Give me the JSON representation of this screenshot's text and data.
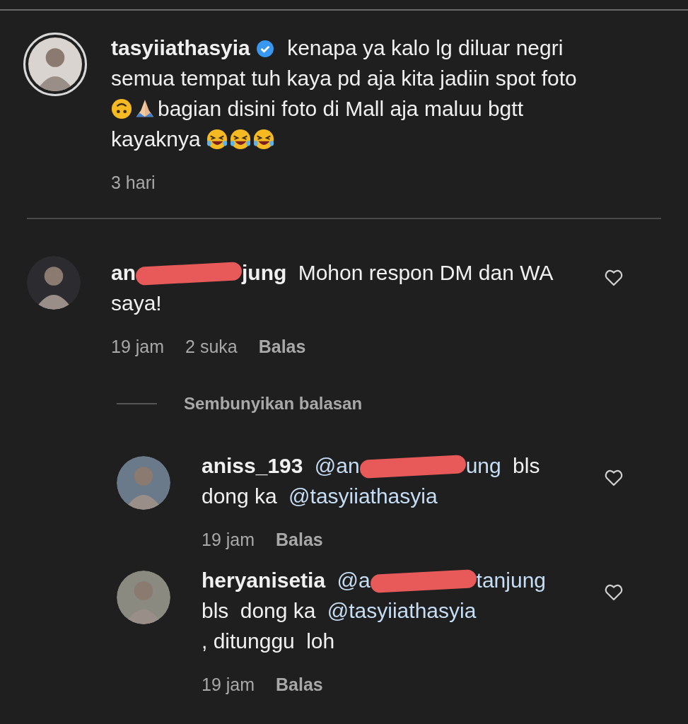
{
  "post": {
    "username": "tasyiiathasyia",
    "verified": true,
    "caption": [
      {
        "kind": "text",
        "text": "kenapa ya kalo lg diluar negri"
      },
      {
        "kind": "text",
        "text": "semua tempat tuh kaya pd aja kita jadiin spot foto"
      },
      {
        "kind": "upside_down_face"
      },
      {
        "kind": "folded_hands"
      },
      {
        "kind": "text",
        "text": "bagian disini foto di Mall aja maluu bgtt"
      },
      {
        "kind": "text",
        "text": "kayaknya"
      },
      {
        "kind": "rolling_laugh"
      },
      {
        "kind": "rolling_laugh"
      },
      {
        "kind": "rolling_laugh"
      }
    ],
    "time": "3 hari"
  },
  "comment": {
    "username": [
      {
        "kind": "text",
        "text": "an"
      },
      {
        "kind": "redaction"
      },
      {
        "kind": "text",
        "text": "jung"
      }
    ],
    "text": [
      {
        "kind": "text",
        "text": "Mohon respon DM dan WA"
      },
      {
        "kind": "text",
        "text": "saya!"
      }
    ],
    "time": "19 jam",
    "likes": "2 suka",
    "reply": "Balas"
  },
  "replies_toggle": "Sembunyikan balasan",
  "replies": [
    {
      "username": [
        {
          "kind": "text",
          "text": "aniss_193"
        }
      ],
      "text": [
        {
          "kind": "mention",
          "text": "@an"
        },
        {
          "kind": "redaction"
        },
        {
          "kind": "mention",
          "text": "ung"
        },
        {
          "kind": "text",
          "text": "bls"
        },
        {
          "kind": "text",
          "text": "dong ka"
        },
        {
          "kind": "mention",
          "text": "@tasyiiathasyia"
        }
      ],
      "time": "19 jam",
      "reply": "Balas"
    },
    {
      "username": [
        {
          "kind": "text",
          "text": "heryanisetia"
        }
      ],
      "text": [
        {
          "kind": "mention",
          "text": "@a"
        },
        {
          "kind": "redaction"
        },
        {
          "kind": "mention",
          "text": "tanjung"
        },
        {
          "kind": "text",
          "text": "bls"
        },
        {
          "kind": "text",
          "text": "dong ka"
        },
        {
          "kind": "mention",
          "text": "@tasyiiathasyia"
        },
        {
          "kind": "text",
          "text": ", ditunggu"
        },
        {
          "kind": "text",
          "text": "loh"
        }
      ],
      "time": "19 jam",
      "reply": "Balas"
    }
  ]
}
